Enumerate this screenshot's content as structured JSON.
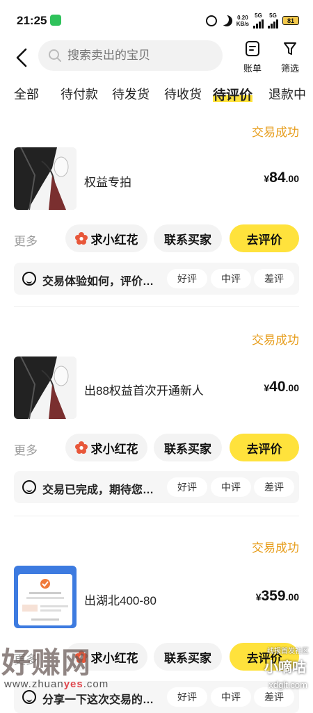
{
  "status_bar": {
    "time": "21:25",
    "net_speed_value": "0.20",
    "net_speed_unit": "KB/s",
    "sim1": "5G",
    "sim2": "5G",
    "battery": "81"
  },
  "header": {
    "search_placeholder": "搜索卖出的宝贝",
    "bill_label": "账单",
    "filter_label": "筛选"
  },
  "tabs": [
    {
      "label": "全部"
    },
    {
      "label": "待付款"
    },
    {
      "label": "待发货"
    },
    {
      "label": "待收货"
    },
    {
      "label": "待评价",
      "active": true
    },
    {
      "label": "退款中"
    }
  ],
  "orders": [
    {
      "status": "交易成功",
      "title": "权益专拍",
      "price_symbol": "¥",
      "price_int": "84",
      "price_dec": ".00",
      "more": "更多",
      "btn_flower": "求小红花",
      "btn_contact": "联系买家",
      "btn_review": "去评价",
      "feedback": "交易体验如何，评价…",
      "rate_good": "好评",
      "rate_mid": "中评",
      "rate_bad": "差评"
    },
    {
      "status": "交易成功",
      "title": "出88权益首次开通新人",
      "price_symbol": "¥",
      "price_int": "40",
      "price_dec": ".00",
      "more": "更多",
      "btn_flower": "求小红花",
      "btn_contact": "联系买家",
      "btn_review": "去评价",
      "feedback": "交易已完成，期待您…",
      "rate_good": "好评",
      "rate_mid": "中评",
      "rate_bad": "差评"
    },
    {
      "status": "交易成功",
      "title": "出湖北400-80",
      "price_symbol": "¥",
      "price_int": "359",
      "price_dec": ".00",
      "more": "更多",
      "btn_flower": "求小红花",
      "btn_contact": "联系买家",
      "btn_review": "去评价",
      "feedback": "分享一下这次交易的…",
      "rate_good": "好评",
      "rate_mid": "中评",
      "rate_bad": "差评"
    }
  ],
  "watermark": {
    "site_big": "好赚网",
    "url_pre": "www.zhuan",
    "url_red": "yes",
    "url_post": ".com",
    "right_top": "线报首发社区",
    "right_brand": "小嘀咕",
    "right_url": "xdglt.com"
  },
  "colors": {
    "accent_yellow": "#ffe23c",
    "status_orange": "#e79d1b"
  }
}
